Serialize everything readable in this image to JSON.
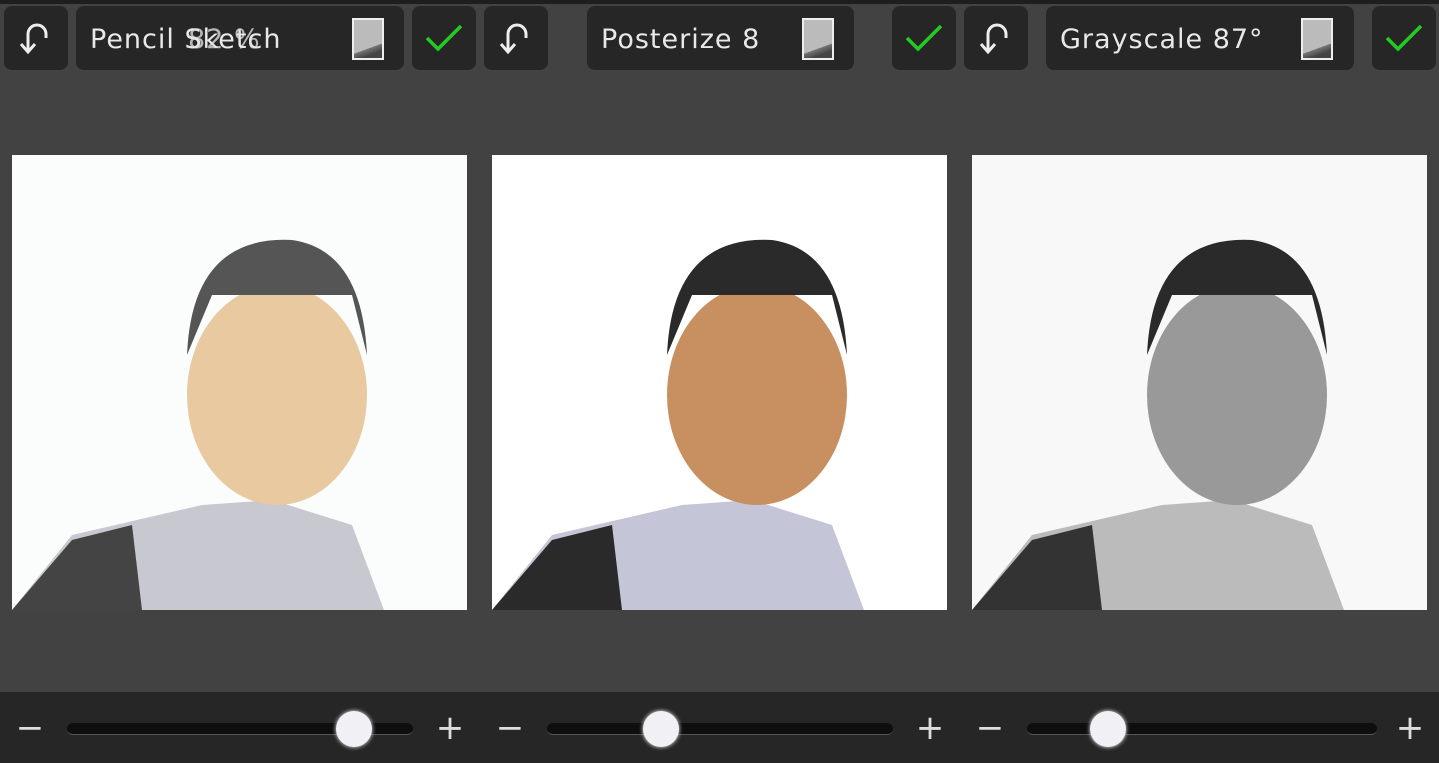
{
  "panels": [
    {
      "title_a": "Pencil Sketch",
      "title_b": "82 %",
      "slider_value": 0.83
    },
    {
      "title_a": "Posterize 8",
      "slider_value": 0.33
    },
    {
      "title_a": "Grayscale 87°",
      "slider_value": 0.23
    }
  ],
  "icons": {
    "undo": "undo-icon",
    "apply": "check-icon",
    "compare": "compare-swatch-icon",
    "minus": "−",
    "plus": "+"
  },
  "colors": {
    "check": "#22cc22",
    "bar": "#262626",
    "bg": "#424242"
  }
}
